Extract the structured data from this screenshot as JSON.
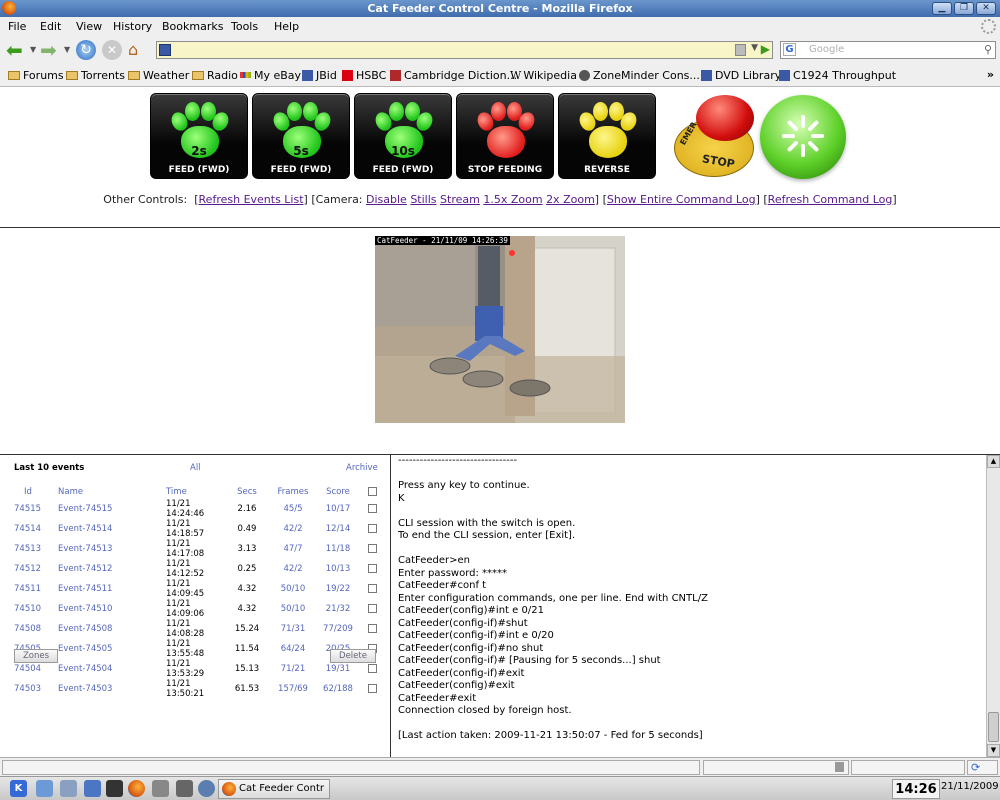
{
  "window": {
    "title": "Cat Feeder Control Centre - Mozilla Firefox"
  },
  "menu": [
    "File",
    "Edit",
    "View",
    "History",
    "Bookmarks",
    "Tools",
    "Help"
  ],
  "search": {
    "placeholder": "Google"
  },
  "bookmarks": [
    "Forums",
    "Torrents",
    "Weather",
    "Radio",
    "My eBay",
    "JBid",
    "HSBC",
    "Cambridge Diction...",
    "Wikipedia",
    "ZoneMinder Cons...",
    "DVD Library",
    "C1924 Throughput"
  ],
  "buttons": {
    "feed2": {
      "pad": "2s",
      "label": "FEED (FWD)"
    },
    "feed5": {
      "pad": "5s",
      "label": "FEED (FWD)"
    },
    "feed10": {
      "pad": "10s",
      "label": "FEED (FWD)"
    },
    "stop": {
      "label": "STOP FEEDING"
    },
    "reverse": {
      "label": "REVERSE"
    },
    "emergency": {
      "top": "EMER",
      "bottom": "STOP"
    }
  },
  "controls": {
    "prefix": "Other Controls:",
    "refresh_events": "Refresh Events List",
    "camera_label": "Camera:",
    "disable": "Disable",
    "stills": "Stills",
    "stream": "Stream",
    "zoom15": "1.5x Zoom",
    "zoom2": "2x Zoom",
    "show_log": "Show Entire Command Log",
    "refresh_log": "Refresh Command Log"
  },
  "camera": {
    "timestamp": "CatFeeder - 21/11/09 14:26:39"
  },
  "events": {
    "title": "Last 10 events",
    "all": "All",
    "archive": "Archive",
    "columns": [
      "Id",
      "Name",
      "Time",
      "Secs",
      "Frames",
      "Score"
    ],
    "rows": [
      [
        "74515",
        "Event-74515",
        "11/21 14:24:46",
        "2.16",
        "45/5",
        "10/17"
      ],
      [
        "74514",
        "Event-74514",
        "11/21 14:18:57",
        "0.49",
        "42/2",
        "12/14"
      ],
      [
        "74513",
        "Event-74513",
        "11/21 14:17:08",
        "3.13",
        "47/7",
        "11/18"
      ],
      [
        "74512",
        "Event-74512",
        "11/21 14:12:52",
        "0.25",
        "42/2",
        "10/13"
      ],
      [
        "74511",
        "Event-74511",
        "11/21 14:09:45",
        "4.32",
        "50/10",
        "19/22"
      ],
      [
        "74510",
        "Event-74510",
        "11/21 14:09:06",
        "4.32",
        "50/10",
        "21/32"
      ],
      [
        "74508",
        "Event-74508",
        "11/21 14:08:28",
        "15.24",
        "71/31",
        "77/209"
      ],
      [
        "74505",
        "Event-74505",
        "11/21 13:55:48",
        "11.54",
        "64/24",
        "20/25"
      ],
      [
        "74504",
        "Event-74504",
        "11/21 13:53:29",
        "15.13",
        "71/21",
        "19/31"
      ],
      [
        "74503",
        "Event-74503",
        "11/21 13:50:21",
        "61.53",
        "157/69",
        "62/188"
      ]
    ],
    "zones": "Zones",
    "delete": "Delete"
  },
  "log": {
    "lines": [
      "---------------------------------",
      "",
      "Press any key to continue.",
      "K",
      "",
      "CLI session with the switch is open.",
      "To end the CLI session, enter [Exit].",
      "",
      "CatFeeder>en",
      "Enter password: *****",
      "CatFeeder#conf t",
      "Enter configuration commands, one per line. End with CNTL/Z",
      "CatFeeder(config)#int e 0/21",
      "CatFeeder(config-if)#shut",
      "CatFeeder(config-if)#int e 0/20",
      "CatFeeder(config-if)#no shut",
      "CatFeeder(config-if)# [Pausing for 5 seconds...] shut",
      "CatFeeder(config-if)#exit",
      "CatFeeder(config)#exit",
      "CatFeeder#exit",
      "Connection closed by foreign host.",
      "",
      "[Last action taken: 2009-11-21 13:50:07 - Fed for 5 seconds]"
    ]
  },
  "taskbar": {
    "task": "Cat Feeder Contr",
    "time": "14:26",
    "date": "21/11/2009"
  }
}
